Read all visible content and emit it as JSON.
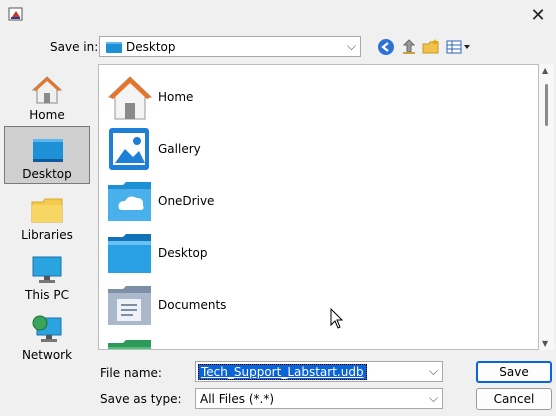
{
  "dialog": {
    "save_in_label": "Save in:",
    "save_in_value": "Desktop",
    "toolbar": [
      "back-icon",
      "up-folder-icon",
      "new-folder-icon",
      "view-menu-icon"
    ]
  },
  "places": [
    {
      "label": "Home",
      "icon": "home-icon"
    },
    {
      "label": "Desktop",
      "icon": "desktop-icon",
      "selected": true
    },
    {
      "label": "Libraries",
      "icon": "libraries-icon"
    },
    {
      "label": "This PC",
      "icon": "this-pc-icon"
    },
    {
      "label": "Network",
      "icon": "network-icon"
    }
  ],
  "files": [
    {
      "name": "Home",
      "icon": "home-icon"
    },
    {
      "name": "Gallery",
      "icon": "gallery-icon"
    },
    {
      "name": "OneDrive",
      "icon": "onedrive-folder-icon"
    },
    {
      "name": "Desktop",
      "icon": "desktop-folder-icon"
    },
    {
      "name": "Documents",
      "icon": "documents-folder-icon"
    }
  ],
  "form": {
    "file_name_label": "File name:",
    "file_name_value": "Tech_Support_Labstart.udb",
    "type_label": "Save as type:",
    "type_value": "All Files (*.*)"
  },
  "buttons": {
    "save": "Save",
    "cancel": "Cancel"
  },
  "colors": {
    "accent": "#0a64d8",
    "selection": "#cfcfcf"
  }
}
